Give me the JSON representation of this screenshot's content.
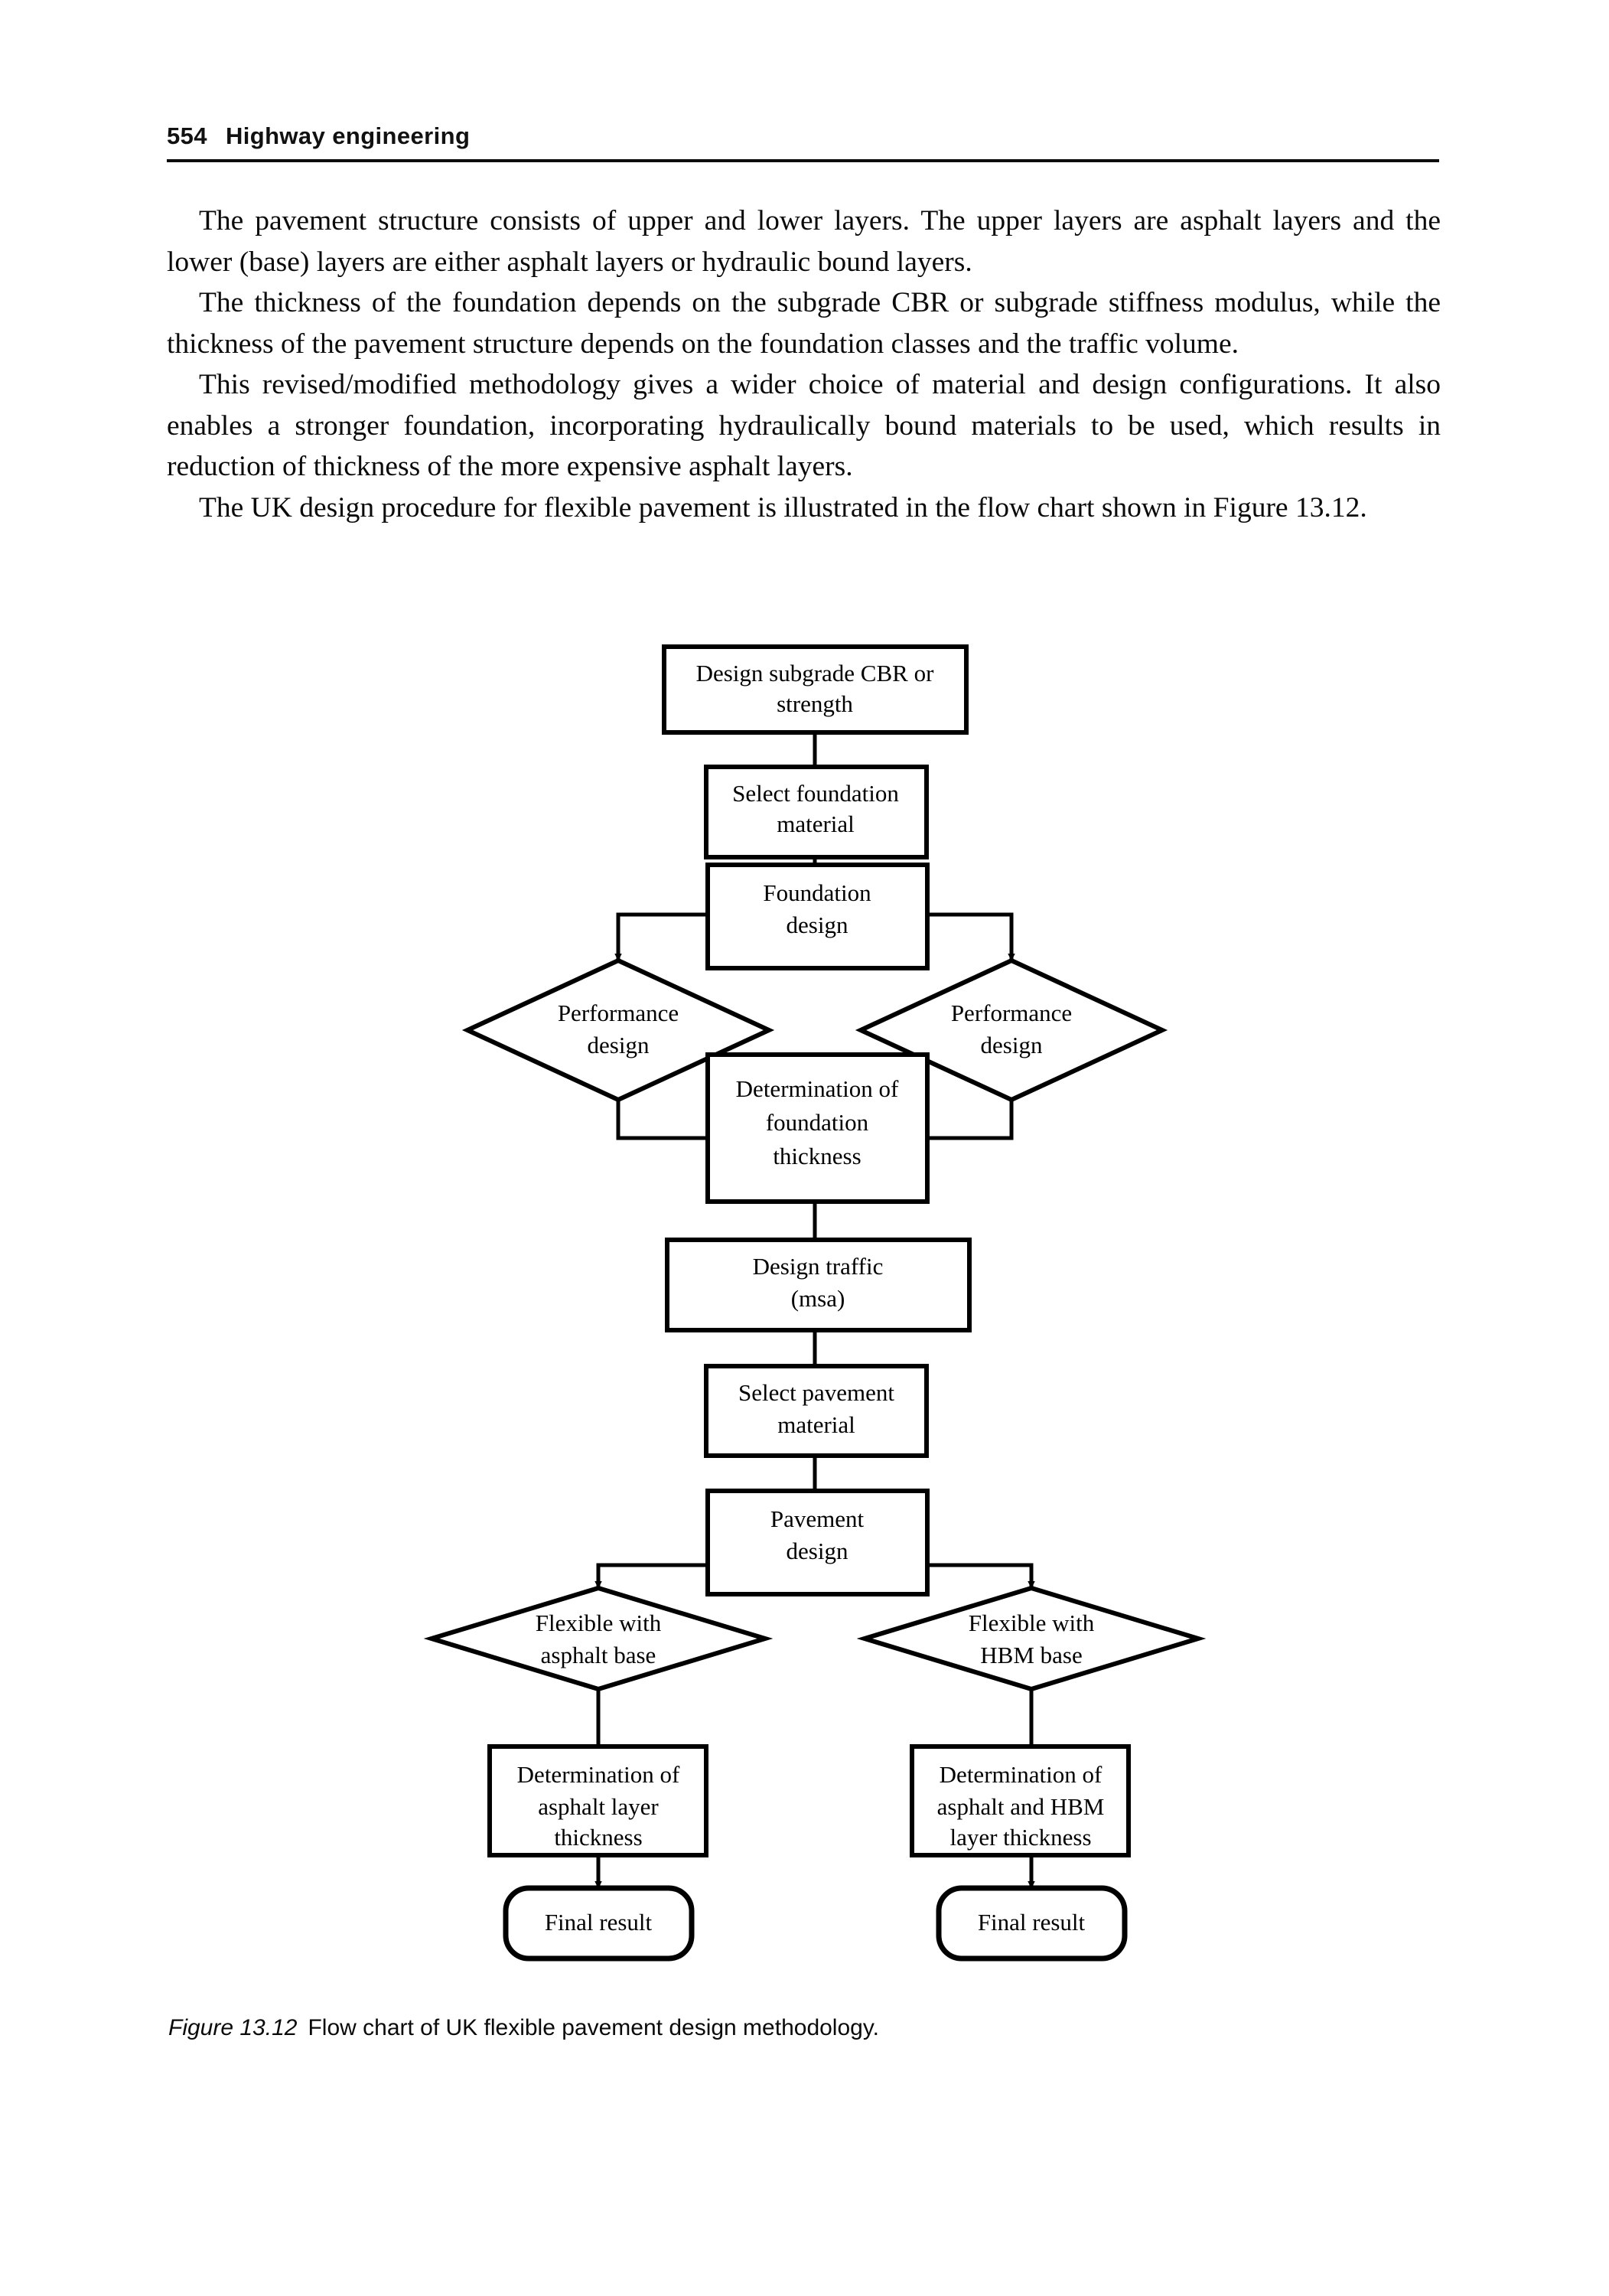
{
  "page": {
    "folio": "554",
    "running_title": "Highway engineering"
  },
  "body": {
    "paragraphs": [
      "The pavement structure consists of upper and lower layers. The upper layers are asphalt layers and the lower (base) layers are either asphalt layers or hydraulic bound layers.",
      "The thickness of the foundation depends on the subgrade CBR or subgrade stiffness modulus, while the thickness of the pavement structure depends on the foundation classes and the traffic volume.",
      "This revised/modified methodology gives a wider choice of material and design configurations. It also enables a stronger foundation, incorporating hydraulically bound materials to be used, which results in reduction of thickness of the more expensive asphalt layers.",
      "The UK design procedure for flexible pavement is illustrated in the flow chart shown in Figure 13.12."
    ]
  },
  "figure": {
    "caption_id": "Figure 13.12",
    "caption_text": "Flow chart of UK flexible pavement design methodology."
  },
  "chart_data": {
    "type": "flowchart",
    "title": "Flow chart of UK flexible pavement design methodology",
    "nodes": [
      {
        "id": "n1",
        "shape": "rect",
        "lines": [
          "Design subgrade CBR or",
          "strength"
        ]
      },
      {
        "id": "n2",
        "shape": "rect",
        "lines": [
          "Select foundation",
          "material"
        ]
      },
      {
        "id": "n3",
        "shape": "rect",
        "lines": [
          "Foundation",
          "design"
        ]
      },
      {
        "id": "n4",
        "shape": "diamond",
        "lines": [
          "Performance",
          "design"
        ]
      },
      {
        "id": "n5",
        "shape": "diamond",
        "lines": [
          "Performance",
          "design"
        ]
      },
      {
        "id": "n6",
        "shape": "rect",
        "lines": [
          "Determination of",
          "foundation",
          "thickness"
        ]
      },
      {
        "id": "n7",
        "shape": "rect",
        "lines": [
          "Design traffic",
          "(msa)"
        ]
      },
      {
        "id": "n8",
        "shape": "rect",
        "lines": [
          "Select pavement",
          "material"
        ]
      },
      {
        "id": "n9",
        "shape": "rect",
        "lines": [
          "Pavement",
          "design"
        ]
      },
      {
        "id": "n10",
        "shape": "diamond",
        "lines": [
          "Flexible with",
          "asphalt base"
        ]
      },
      {
        "id": "n11",
        "shape": "diamond",
        "lines": [
          "Flexible with",
          "HBM base"
        ]
      },
      {
        "id": "n12",
        "shape": "rect",
        "lines": [
          "Determination of",
          "asphalt layer",
          "thickness"
        ]
      },
      {
        "id": "n13",
        "shape": "rect",
        "lines": [
          "Determination of",
          "asphalt and HBM",
          "layer thickness"
        ]
      },
      {
        "id": "n14",
        "shape": "rounded",
        "lines": [
          "Final result"
        ]
      },
      {
        "id": "n15",
        "shape": "rounded",
        "lines": [
          "Final result"
        ]
      }
    ],
    "edges": [
      {
        "from": "n1",
        "to": "n2",
        "arrow": false
      },
      {
        "from": "n2",
        "to": "n3",
        "arrow": false
      },
      {
        "from": "n3",
        "to": "n4",
        "arrow": true
      },
      {
        "from": "n3",
        "to": "n5",
        "arrow": true
      },
      {
        "from": "n4",
        "to": "n6",
        "arrow": false
      },
      {
        "from": "n5",
        "to": "n6",
        "arrow": false
      },
      {
        "from": "n6",
        "to": "n7",
        "arrow": false
      },
      {
        "from": "n7",
        "to": "n8",
        "arrow": false
      },
      {
        "from": "n8",
        "to": "n9",
        "arrow": false
      },
      {
        "from": "n9",
        "to": "n10",
        "arrow": true
      },
      {
        "from": "n9",
        "to": "n11",
        "arrow": true
      },
      {
        "from": "n10",
        "to": "n12",
        "arrow": false
      },
      {
        "from": "n11",
        "to": "n13",
        "arrow": false
      },
      {
        "from": "n12",
        "to": "n14",
        "arrow": true
      },
      {
        "from": "n13",
        "to": "n15",
        "arrow": true
      }
    ]
  }
}
